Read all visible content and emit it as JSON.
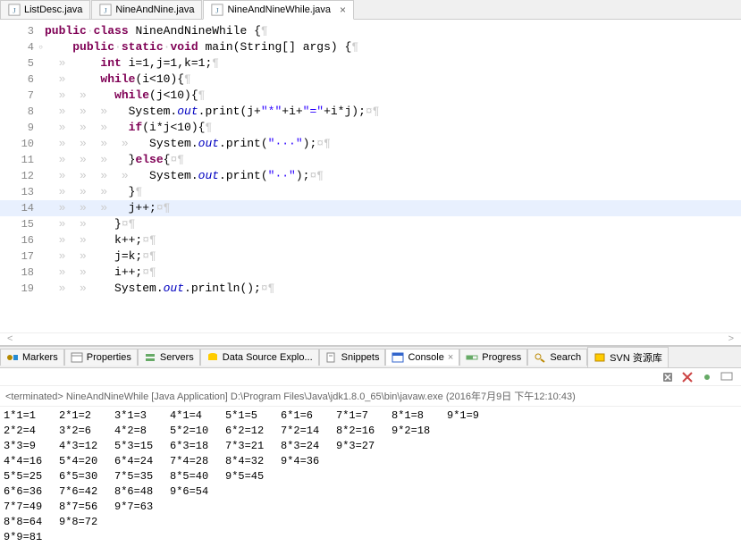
{
  "tabs": [
    {
      "label": "ListDesc.java",
      "active": false
    },
    {
      "label": "NineAndNine.java",
      "active": false
    },
    {
      "label": "NineAndNineWhile.java",
      "active": true
    }
  ],
  "code": [
    {
      "n": 3,
      "tokens": [
        {
          "t": "kw",
          "v": "public"
        },
        {
          "t": "ws",
          "v": "·"
        },
        {
          "t": "kw",
          "v": "class"
        },
        {
          "t": "p",
          "v": " NineAndNineWhile {"
        },
        {
          "t": "ws",
          "v": "¶"
        }
      ]
    },
    {
      "n": 4,
      "circle": true,
      "tokens": [
        {
          "t": "ws",
          "v": "    "
        },
        {
          "t": "kw",
          "v": "public"
        },
        {
          "t": "ws",
          "v": "·"
        },
        {
          "t": "kw",
          "v": "static"
        },
        {
          "t": "ws",
          "v": "·"
        },
        {
          "t": "kw",
          "v": "void"
        },
        {
          "t": "p",
          "v": " main(String[] args) {"
        },
        {
          "t": "ws",
          "v": "¶"
        }
      ]
    },
    {
      "n": 5,
      "tokens": [
        {
          "t": "ws",
          "v": "  »     "
        },
        {
          "t": "kw",
          "v": "int"
        },
        {
          "t": "p",
          "v": " i=1,j=1,k=1;"
        },
        {
          "t": "ws",
          "v": "¶"
        }
      ]
    },
    {
      "n": 6,
      "tokens": [
        {
          "t": "ws",
          "v": "  »     "
        },
        {
          "t": "kw",
          "v": "while"
        },
        {
          "t": "p",
          "v": "(i<10){"
        },
        {
          "t": "ws",
          "v": "¶"
        }
      ]
    },
    {
      "n": 7,
      "tokens": [
        {
          "t": "ws",
          "v": "  »  »    "
        },
        {
          "t": "kw",
          "v": "while"
        },
        {
          "t": "p",
          "v": "(j<10){"
        },
        {
          "t": "ws",
          "v": "¶"
        }
      ]
    },
    {
      "n": 8,
      "tokens": [
        {
          "t": "ws",
          "v": "  »  »  »   "
        },
        {
          "t": "p",
          "v": "System."
        },
        {
          "t": "field",
          "v": "out"
        },
        {
          "t": "p",
          "v": ".print(j+"
        },
        {
          "t": "str",
          "v": "\"*\""
        },
        {
          "t": "p",
          "v": "+i+"
        },
        {
          "t": "str",
          "v": "\"=\""
        },
        {
          "t": "p",
          "v": "+i*j);"
        },
        {
          "t": "ws",
          "v": "¤¶"
        }
      ]
    },
    {
      "n": 9,
      "tokens": [
        {
          "t": "ws",
          "v": "  »  »  »   "
        },
        {
          "t": "kw",
          "v": "if"
        },
        {
          "t": "p",
          "v": "(i*j<10){"
        },
        {
          "t": "ws",
          "v": "¶"
        }
      ]
    },
    {
      "n": 10,
      "tokens": [
        {
          "t": "ws",
          "v": "  »  »  »  »   "
        },
        {
          "t": "p",
          "v": "System."
        },
        {
          "t": "field",
          "v": "out"
        },
        {
          "t": "p",
          "v": ".print("
        },
        {
          "t": "str",
          "v": "\"···\""
        },
        {
          "t": "p",
          "v": ");"
        },
        {
          "t": "ws",
          "v": "¤¶"
        }
      ]
    },
    {
      "n": 11,
      "tokens": [
        {
          "t": "ws",
          "v": "  »  »  »   "
        },
        {
          "t": "p",
          "v": "}"
        },
        {
          "t": "kw",
          "v": "else"
        },
        {
          "t": "p",
          "v": "{"
        },
        {
          "t": "ws",
          "v": "¤¶"
        }
      ]
    },
    {
      "n": 12,
      "tokens": [
        {
          "t": "ws",
          "v": "  »  »  »  »   "
        },
        {
          "t": "p",
          "v": "System."
        },
        {
          "t": "field",
          "v": "out"
        },
        {
          "t": "p",
          "v": ".print("
        },
        {
          "t": "str",
          "v": "\"··\""
        },
        {
          "t": "p",
          "v": ");"
        },
        {
          "t": "ws",
          "v": "¤¶"
        }
      ]
    },
    {
      "n": 13,
      "tokens": [
        {
          "t": "ws",
          "v": "  »  »  »   "
        },
        {
          "t": "p",
          "v": "}"
        },
        {
          "t": "ws",
          "v": "¶"
        }
      ]
    },
    {
      "n": 14,
      "hl": true,
      "tokens": [
        {
          "t": "ws",
          "v": "  »  »  »   "
        },
        {
          "t": "p",
          "v": "j++;"
        },
        {
          "t": "ws",
          "v": "¤¶"
        }
      ]
    },
    {
      "n": 15,
      "tokens": [
        {
          "t": "ws",
          "v": "  »  »    "
        },
        {
          "t": "p",
          "v": "}"
        },
        {
          "t": "ws",
          "v": "¤¶"
        }
      ]
    },
    {
      "n": 16,
      "tokens": [
        {
          "t": "ws",
          "v": "  »  »    "
        },
        {
          "t": "p",
          "v": "k++;"
        },
        {
          "t": "ws",
          "v": "¤¶"
        }
      ]
    },
    {
      "n": 17,
      "tokens": [
        {
          "t": "ws",
          "v": "  »  »    "
        },
        {
          "t": "p",
          "v": "j=k;"
        },
        {
          "t": "ws",
          "v": "¤¶"
        }
      ]
    },
    {
      "n": 18,
      "tokens": [
        {
          "t": "ws",
          "v": "  »  »    "
        },
        {
          "t": "p",
          "v": "i++;"
        },
        {
          "t": "ws",
          "v": "¤¶"
        }
      ]
    },
    {
      "n": 19,
      "tokens": [
        {
          "t": "ws",
          "v": "  »  »    "
        },
        {
          "t": "p",
          "v": "System."
        },
        {
          "t": "field",
          "v": "out"
        },
        {
          "t": "p",
          "v": ".println();"
        },
        {
          "t": "ws",
          "v": "¤¶"
        }
      ]
    }
  ],
  "view_tabs": [
    {
      "label": "Markers",
      "icon": "markers"
    },
    {
      "label": "Properties",
      "icon": "properties"
    },
    {
      "label": "Servers",
      "icon": "servers"
    },
    {
      "label": "Data Source Explo...",
      "icon": "data-source"
    },
    {
      "label": "Snippets",
      "icon": "snippets"
    },
    {
      "label": "Console",
      "icon": "console",
      "active": true,
      "closable": true
    },
    {
      "label": "Progress",
      "icon": "progress"
    },
    {
      "label": "Search",
      "icon": "search"
    },
    {
      "label": "SVN 资源库",
      "icon": "svn"
    }
  ],
  "console_status": "<terminated> NineAndNineWhile [Java Application] D:\\Program Files\\Java\\jdk1.8.0_65\\bin\\javaw.exe (2016年7月9日 下午12:10:43)",
  "output": [
    [
      "1*1=1",
      "2*1=2",
      "3*1=3",
      "4*1=4",
      "5*1=5",
      "6*1=6",
      "7*1=7",
      "8*1=8",
      "9*1=9"
    ],
    [
      "2*2=4",
      "3*2=6",
      "4*2=8",
      "5*2=10",
      "6*2=12",
      "7*2=14",
      "8*2=16",
      "9*2=18"
    ],
    [
      "3*3=9",
      "4*3=12",
      "5*3=15",
      "6*3=18",
      "7*3=21",
      "8*3=24",
      "9*3=27"
    ],
    [
      "4*4=16",
      "5*4=20",
      "6*4=24",
      "7*4=28",
      "8*4=32",
      "9*4=36"
    ],
    [
      "5*5=25",
      "6*5=30",
      "7*5=35",
      "8*5=40",
      "9*5=45"
    ],
    [
      "6*6=36",
      "7*6=42",
      "8*6=48",
      "9*6=54"
    ],
    [
      "7*7=49",
      "8*7=56",
      "9*7=63"
    ],
    [
      "8*8=64",
      "9*8=72"
    ],
    [
      "9*9=81"
    ]
  ]
}
